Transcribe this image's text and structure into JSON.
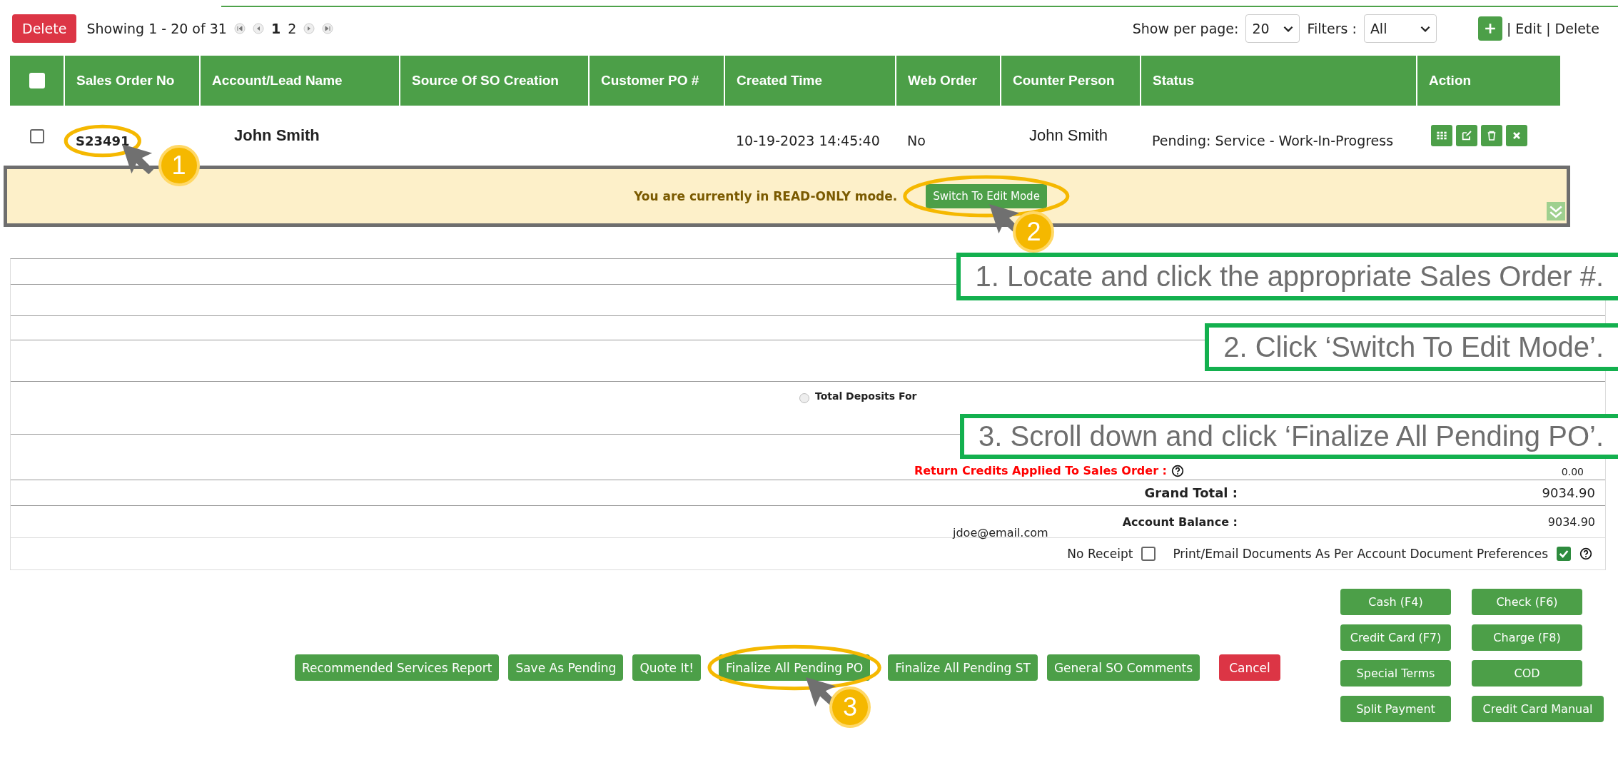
{
  "toolbar": {
    "delete": "Delete",
    "showing": "Showing 1 - 20 of 31",
    "pages": [
      {
        "label": "1",
        "selected": true
      },
      {
        "label": "2",
        "selected": false
      }
    ],
    "per_page_label": "Show per page:",
    "per_page": "20",
    "filters_label": "Filters :",
    "filter": "All",
    "links": [
      "| Edit",
      "| Delete"
    ]
  },
  "table": {
    "select_all": {
      "checked": false
    },
    "columns": [
      "Sales Order No",
      "Account/Lead Name",
      "Source Of SO Creation",
      "Customer PO #",
      "Created Time",
      "Web Order",
      "Counter Person",
      "Status",
      "Action"
    ],
    "rows": [
      {
        "checked": false,
        "cells": [
          "S23491",
          "John Smith",
          "",
          "",
          "10-19-2023 14:45:40",
          "No",
          "John Smith",
          "Pending: Service - Work-In-Progress"
        ]
      }
    ]
  },
  "banner": {
    "message": "You are currently in READ-ONLY mode.",
    "button": "Switch To Edit Mode"
  },
  "summary": {
    "deposits": {
      "label": "Total Deposits For",
      "selected": false
    },
    "return_credits": {
      "label": "Return Credits Applied To Sales Order :",
      "value": "0.00"
    },
    "grand_total": {
      "label": "Grand Total :",
      "value": "9034.90"
    },
    "balance": {
      "label": "Account Balance :",
      "value": "9034.90"
    },
    "email": "jdoe@email.com",
    "options": [
      {
        "label": "No Receipt",
        "checked": false
      },
      {
        "label": "Print/Email Documents As Per Account Document Preferences",
        "checked": true
      }
    ]
  },
  "actions": [
    {
      "label": "Recommended Services Report",
      "kind": "primary"
    },
    {
      "label": "Save As Pending",
      "kind": "primary"
    },
    {
      "label": "Quote It!",
      "kind": "primary"
    },
    {
      "label": "Finalize All Pending PO",
      "kind": "primary"
    },
    {
      "label": "Finalize All Pending ST",
      "kind": "primary"
    },
    {
      "label": "General SO Comments",
      "kind": "primary"
    },
    {
      "label": "Cancel",
      "kind": "danger"
    }
  ],
  "payments": [
    "Cash (F4)",
    "Check (F6)",
    "Credit Card (F7)",
    "Charge (F8)",
    "Special Terms",
    "COD",
    "Split Payment",
    "Credit Card Manual"
  ],
  "callouts": [
    "1. Locate and click the appropriate Sales Order #.",
    "2. Click ‘Switch To Edit Mode’.",
    "3. Scroll down and click ‘Finalize All Pending PO’."
  ],
  "steps": [
    "1",
    "2",
    "3"
  ]
}
